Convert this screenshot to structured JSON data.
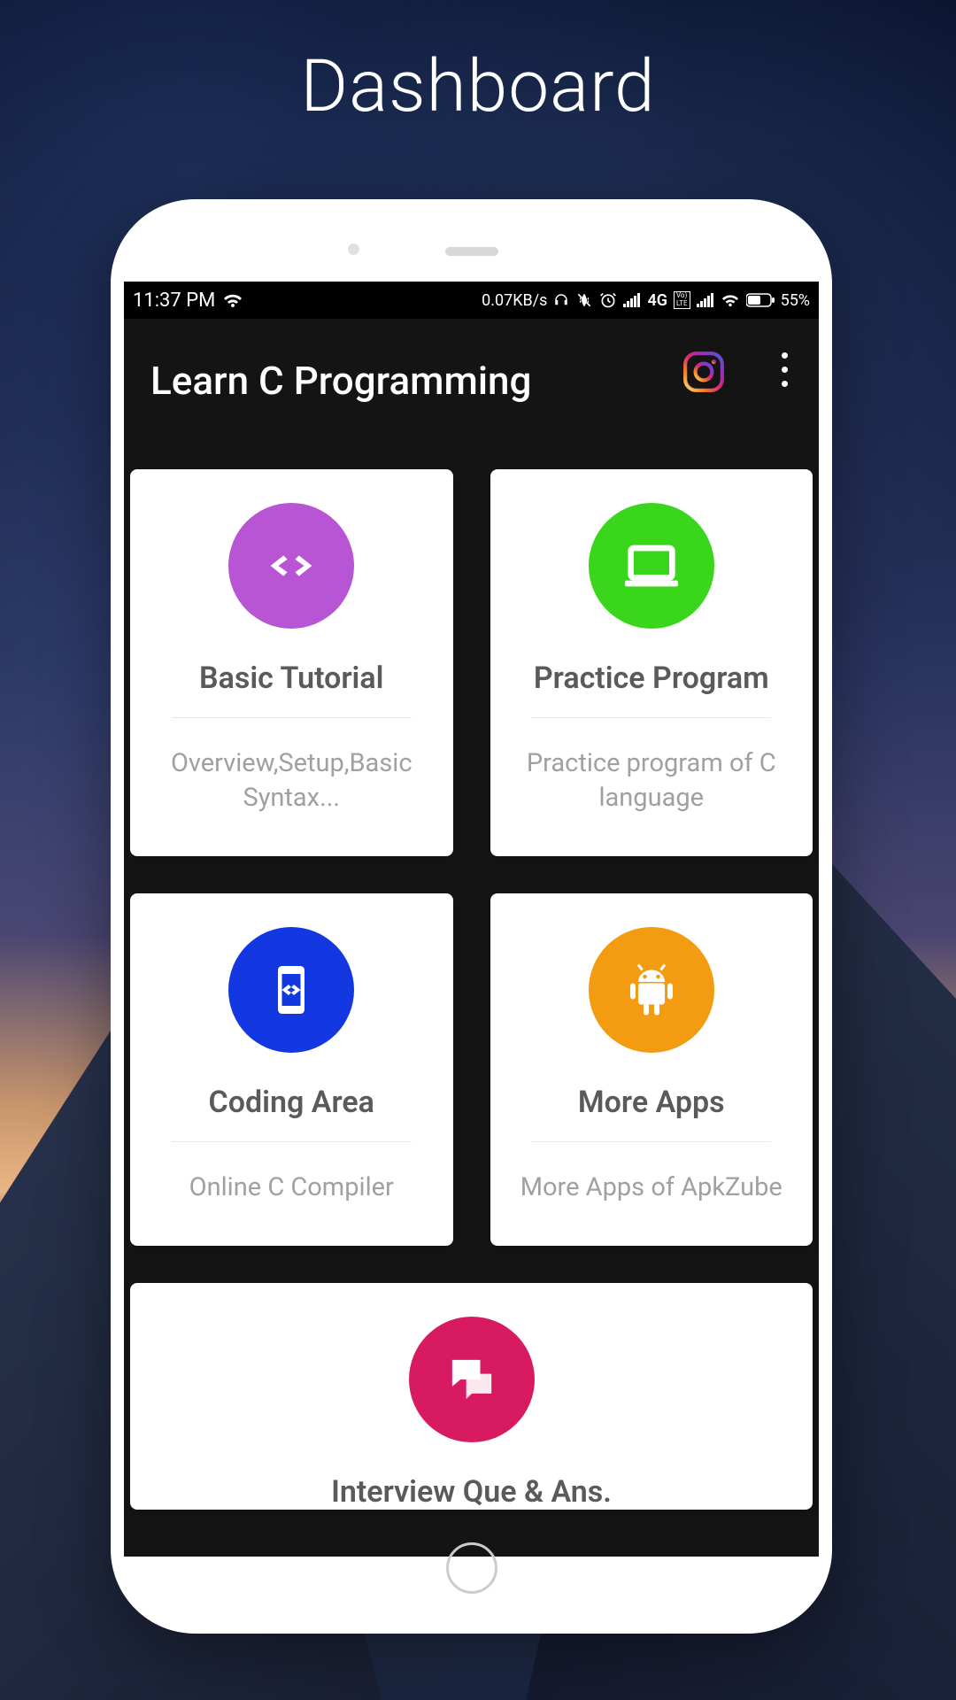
{
  "page_title": "Dashboard",
  "status_bar": {
    "time": "11:37 PM",
    "data_rate": "0.07KB/s",
    "network": "4G",
    "volte": "VoLTE",
    "battery": "55%"
  },
  "header": {
    "title": "Learn C Programming"
  },
  "cards": [
    {
      "title": "Basic Tutorial",
      "desc": "Overview,Setup,Basic Syntax...",
      "icon": "code",
      "color": "purple"
    },
    {
      "title": "Practice Program",
      "desc": "Practice program of C language",
      "icon": "laptop",
      "color": "green"
    },
    {
      "title": "Coding Area",
      "desc": "Online C Compiler",
      "icon": "device",
      "color": "blue"
    },
    {
      "title": "More Apps",
      "desc": "More Apps of ApkZube",
      "icon": "android",
      "color": "orange"
    }
  ],
  "wide_card": {
    "title": "Interview Que & Ans.",
    "icon": "chat",
    "color": "pink"
  }
}
